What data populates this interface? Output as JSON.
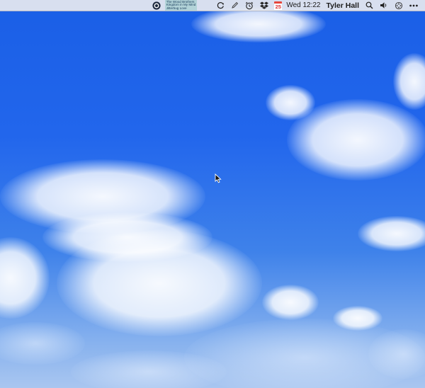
{
  "menubar": {
    "now_playing": {
      "artist": "The Wood Brothers",
      "album": "Kingdom in My Mind",
      "track": "Jitterbug Love"
    },
    "calendar_day": "25",
    "clock": "Wed 12:22",
    "user_name": "Tyler Hall",
    "icons": [
      "record-app-icon",
      "sync-icon",
      "pen-icon",
      "alarm-clock-icon",
      "dropbox-icon",
      "calendar-icon",
      "search-icon",
      "volume-icon",
      "network-icon",
      "more-icon"
    ]
  },
  "desktop": {
    "wallpaper": "blue sky with clouds",
    "colors": {
      "sky_top": "#1a5fe6",
      "sky_bottom": "#a9c6f0",
      "menubar_bg": "#e8eaf0",
      "calendar_red": "#e5463b"
    }
  }
}
